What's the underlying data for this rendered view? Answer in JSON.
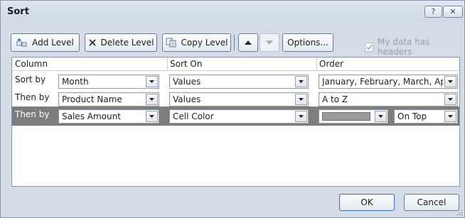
{
  "window": {
    "title": "Sort",
    "help_label": "?",
    "close_label": "✕"
  },
  "toolbar": {
    "add_level_label": "Add Level",
    "delete_level_label": "Delete Level",
    "copy_level_label": "Copy Level",
    "move_up_icon": "triangle-up",
    "move_down_icon": "triangle-down",
    "options_label": "Options...",
    "headers_checkbox_label": "My data has headers",
    "headers_checkbox_checked": true,
    "headers_checkbox_disabled": true
  },
  "grid": {
    "headers": {
      "column": "Column",
      "sort_on": "Sort On",
      "order": "Order"
    },
    "rows": [
      {
        "label": "Sort by",
        "column": "Month",
        "sort_on": "Values",
        "order": "January, February, March, April,",
        "selected": false
      },
      {
        "label": "Then by",
        "column": "Product Name",
        "sort_on": "Values",
        "order": "A to Z",
        "selected": false
      },
      {
        "label": "Then by",
        "column": "Sales Amount",
        "sort_on": "Cell Color",
        "order_color": "#9a9a9a",
        "position": "On Top",
        "selected": true
      }
    ]
  },
  "footer": {
    "ok_label": "OK",
    "cancel_label": "Cancel"
  },
  "colors": {
    "selected_row_bg": "#7d7d7d",
    "window_bg": "#d4dce7",
    "border": "#8a96a8"
  }
}
